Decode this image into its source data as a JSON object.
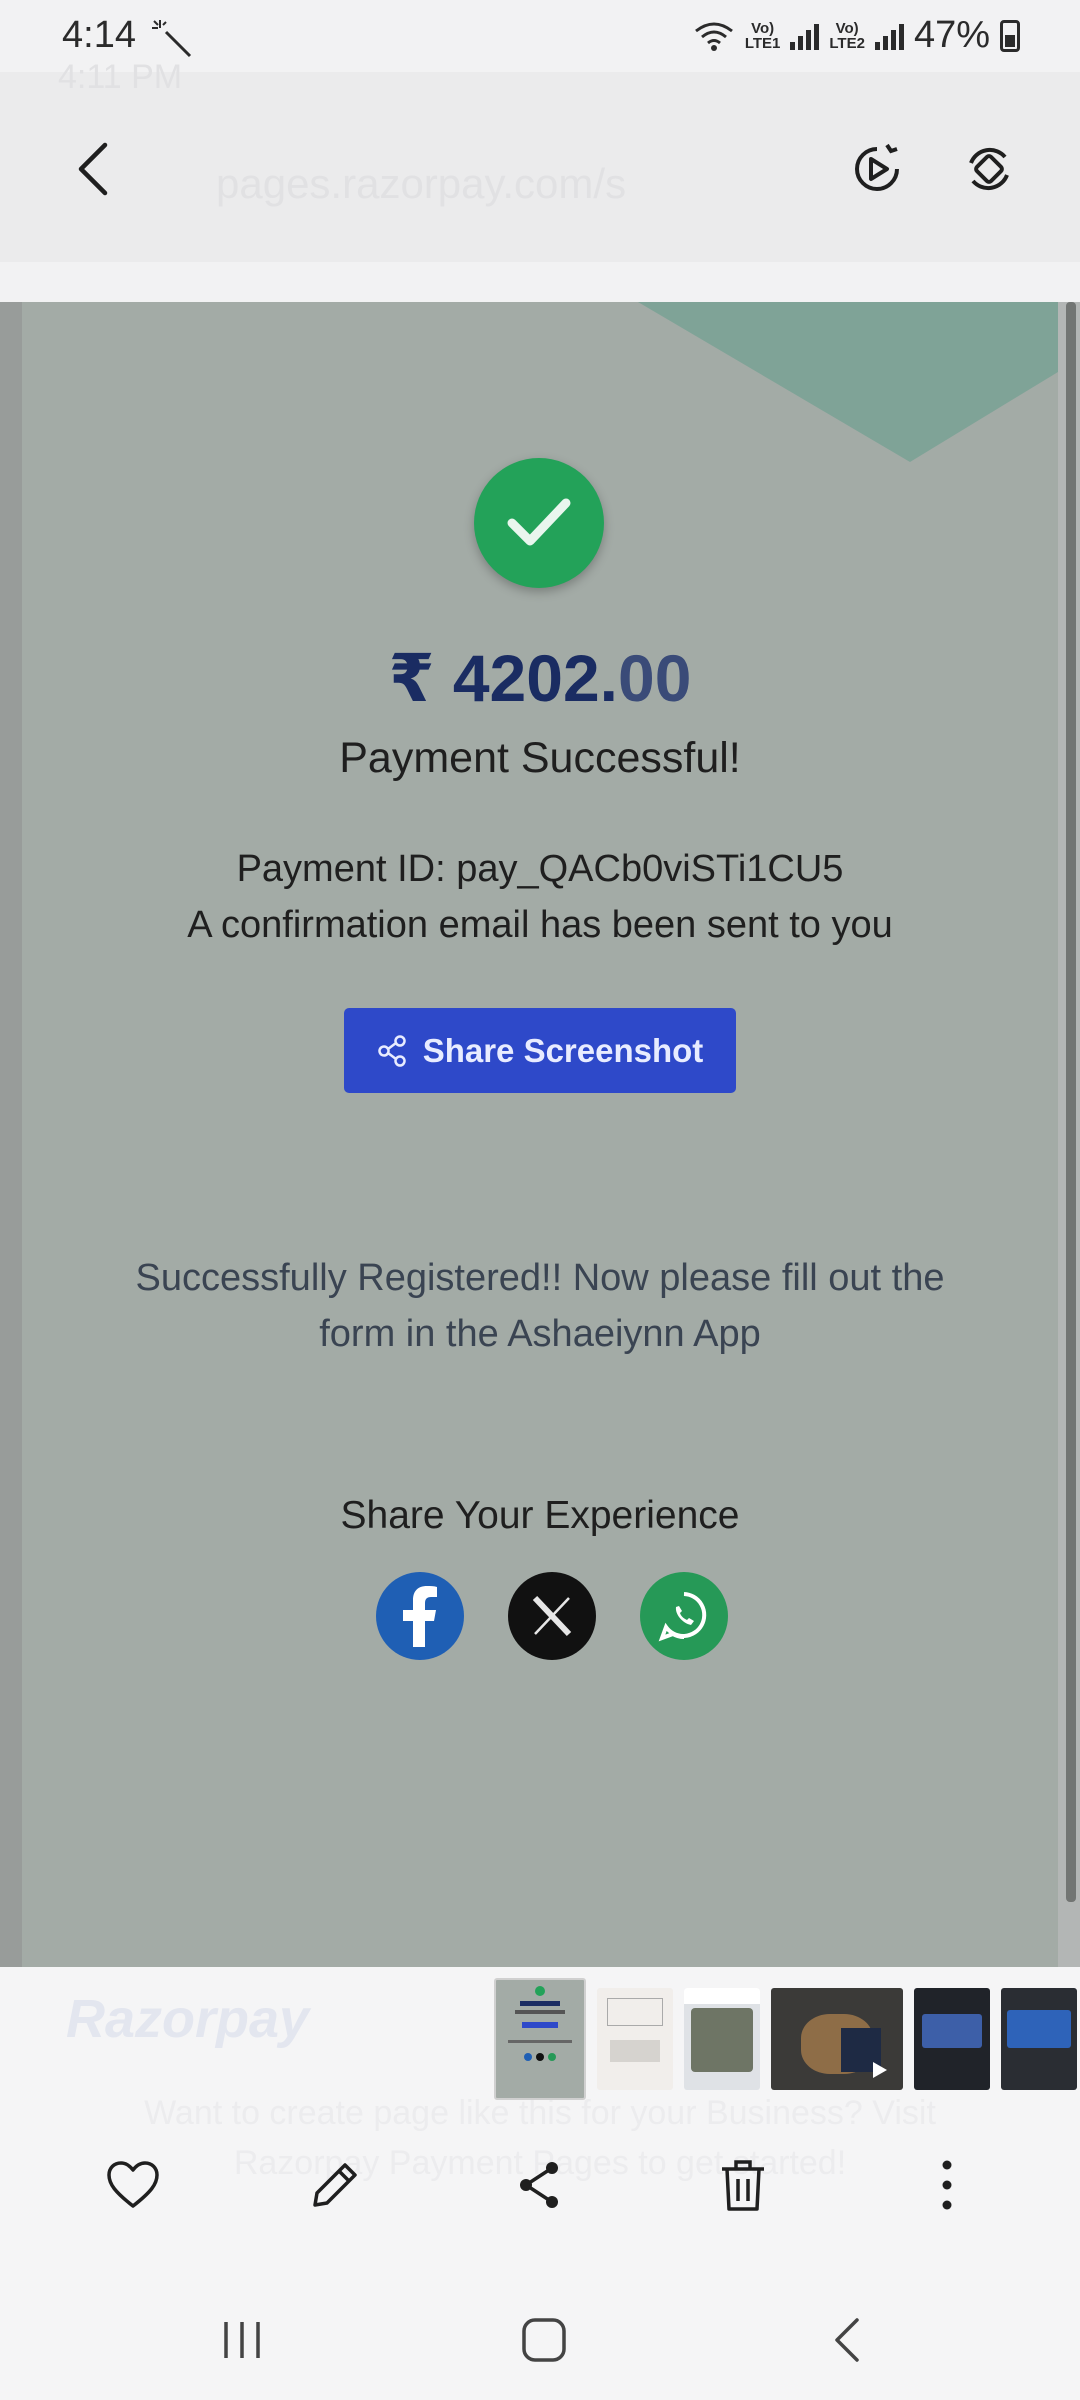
{
  "status_bar": {
    "time": "4:14",
    "battery_percent": "47%",
    "sim1": "LTE1",
    "sim2": "LTE2"
  },
  "background_ghost": {
    "time": "4:11 PM",
    "url": "pages.razorpay.com/s",
    "brand": "Razorpay",
    "promo_line1": "Want to create page like this for your Business? Visit",
    "promo_line2": "Razorpay Payment Pages to get started!"
  },
  "payment": {
    "amount_main": "₹ 4202.",
    "amount_decimal": "00",
    "status": "Payment Successful!",
    "payment_id": "Payment ID: pay_QACb0viSTi1CU5",
    "email_note": "A confirmation email has been sent to you",
    "share_button": "Share Screenshot",
    "registered_message": "Successfully Registered!! Now please fill out the form in the Ashaeiynn App",
    "share_title": "Share Your Experience"
  },
  "colors": {
    "success_green": "#23a259",
    "amount_navy": "#1a2c62",
    "share_button_blue": "#2e49c9",
    "facebook": "#1f5fb4",
    "whatsapp": "#269957"
  },
  "icons": {
    "top_bar": [
      "back-arrow-icon",
      "play-video-icon",
      "rotate-icon"
    ],
    "actions": [
      "heart-icon",
      "pencil-icon",
      "share-icon",
      "trash-icon",
      "more-vertical-icon"
    ],
    "nav": [
      "recents-icon",
      "home-icon",
      "back-icon"
    ]
  }
}
